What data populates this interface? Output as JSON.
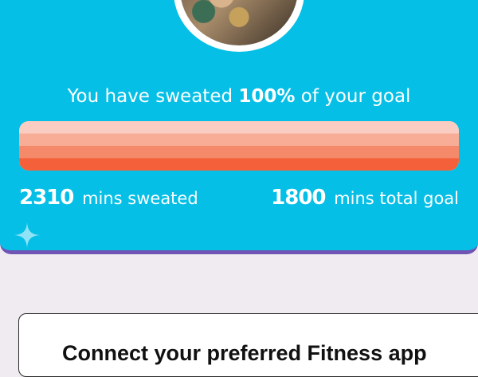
{
  "goal_card": {
    "headline": {
      "prefix": "You have sweated ",
      "percent": "100%",
      "suffix": " of your goal"
    },
    "progress_fraction": 1.0,
    "sweated": {
      "value": "2310",
      "label": "mins sweated"
    },
    "total_goal": {
      "value": "1800",
      "label": "mins total goal"
    },
    "icons": {
      "avatar": "profile-photo",
      "decoration": "sparkle-icon"
    },
    "colors": {
      "card_background": "#05bfe6",
      "card_border": "#6f54b4",
      "progress_orange": "#f4603a",
      "page_background": "#efebf1"
    }
  },
  "connect_card": {
    "title": "Connect your preferred Fitness app"
  }
}
